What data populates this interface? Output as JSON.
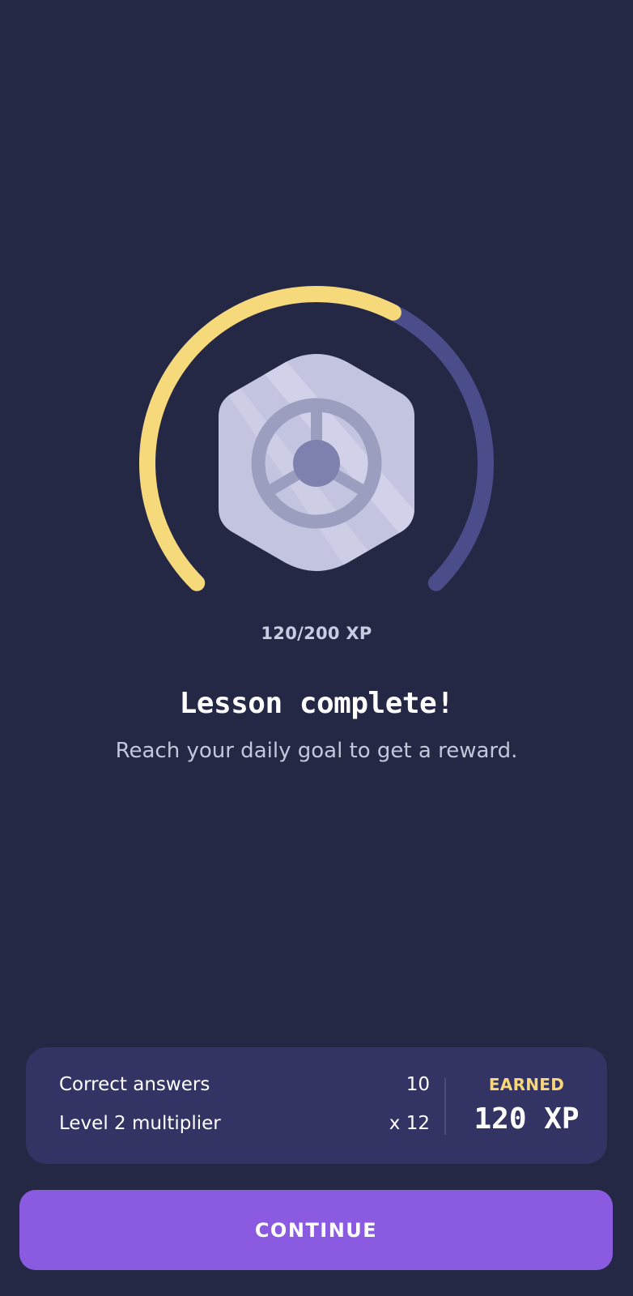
{
  "progress": {
    "current_xp": 120,
    "goal_xp": 200,
    "text": "120/200 XP",
    "fill_color": "#f6d97a",
    "track_color": "#4b4d8a"
  },
  "badge": {
    "icon": "steering-wheel-icon",
    "colors": {
      "hex_fill": "#c3c4df",
      "wheel": "#9b9ebf",
      "hub": "#7e80ad"
    }
  },
  "heading": {
    "title": "Lesson complete!",
    "subtitle": "Reach your daily goal to get a reward."
  },
  "summary": {
    "rows": [
      {
        "label": "Correct answers",
        "value": "10"
      },
      {
        "label": "Level 2 multiplier",
        "value": "x 12"
      }
    ],
    "earned_label": "EARNED",
    "earned_value": "120 XP"
  },
  "actions": {
    "continue_label": "CONTINUE"
  },
  "colors": {
    "background": "#252845",
    "card": "#333463",
    "accent_button": "#8a5be0",
    "earned_label": "#f7d77a"
  }
}
